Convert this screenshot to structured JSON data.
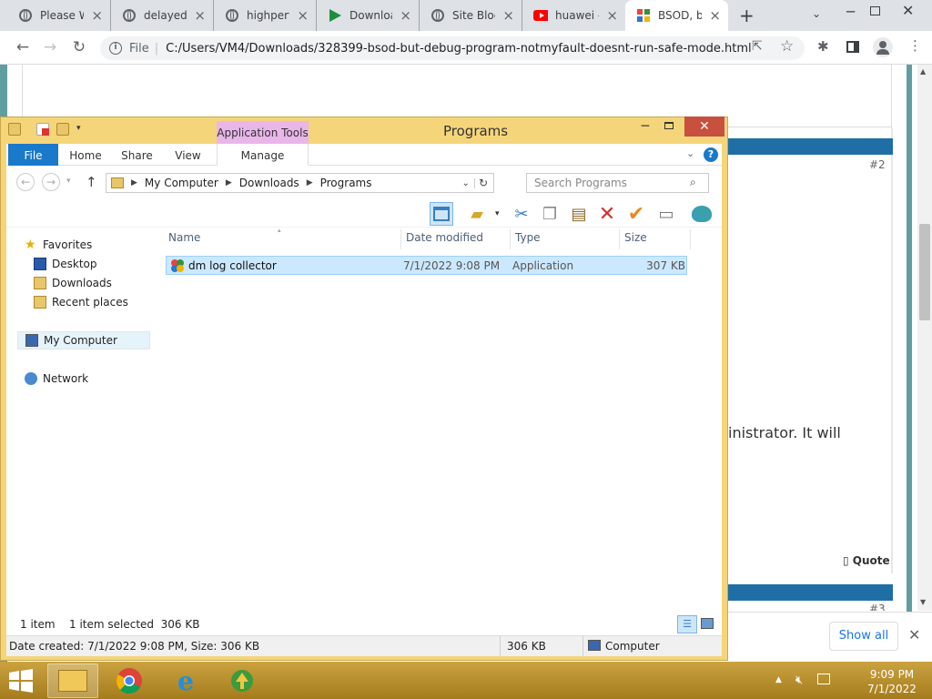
{
  "browser": {
    "tabs": [
      {
        "label": "Please W",
        "icon": "globe-icon"
      },
      {
        "label": "delayedd",
        "icon": "globe-icon"
      },
      {
        "label": "highperf",
        "icon": "globe-icon"
      },
      {
        "label": "Downloa",
        "icon": "play-icon"
      },
      {
        "label": "Site Bloc",
        "icon": "globe-icon"
      },
      {
        "label": "huawei -",
        "icon": "youtube-icon"
      },
      {
        "label": "BSOD, b",
        "icon": "bsod-site-icon"
      }
    ],
    "new_tab": "+",
    "address_scheme": "File",
    "address": "C:/Users/VM4/Downloads/328399-bsod-but-debug-program-notmyfault-doesnt-run-safe-mode.html"
  },
  "page": {
    "post_number": "#2",
    "post_number_2": "#3",
    "body_fragment": "inistrator. It will",
    "quote_label": "Quote"
  },
  "downloads": {
    "show_all": "Show all"
  },
  "explorer": {
    "title": "Programs",
    "context_tab": "Application Tools",
    "ribbon_tabs": [
      "File",
      "Home",
      "Share",
      "View",
      "Manage"
    ],
    "breadcrumb": [
      "My Computer",
      "Downloads",
      "Programs"
    ],
    "search_placeholder": "Search Programs",
    "nav": {
      "favorites": "Favorites",
      "desktop": "Desktop",
      "downloads": "Downloads",
      "recent": "Recent places",
      "computer": "My Computer",
      "network": "Network"
    },
    "columns": [
      "Name",
      "Date modified",
      "Type",
      "Size"
    ],
    "files": [
      {
        "name": "dm log collector",
        "date": "7/1/2022 9:08 PM",
        "type": "Application",
        "size": "307 KB"
      }
    ],
    "status": {
      "count": "1 item",
      "selected": "1 item selected  306 KB"
    },
    "details": {
      "created": "Date created: 7/1/2022 9:08 PM, Size: 306 KB",
      "size": "306 KB",
      "location": "Computer"
    }
  },
  "taskbar": {
    "time": "9:09 PM",
    "date": "7/1/2022"
  }
}
